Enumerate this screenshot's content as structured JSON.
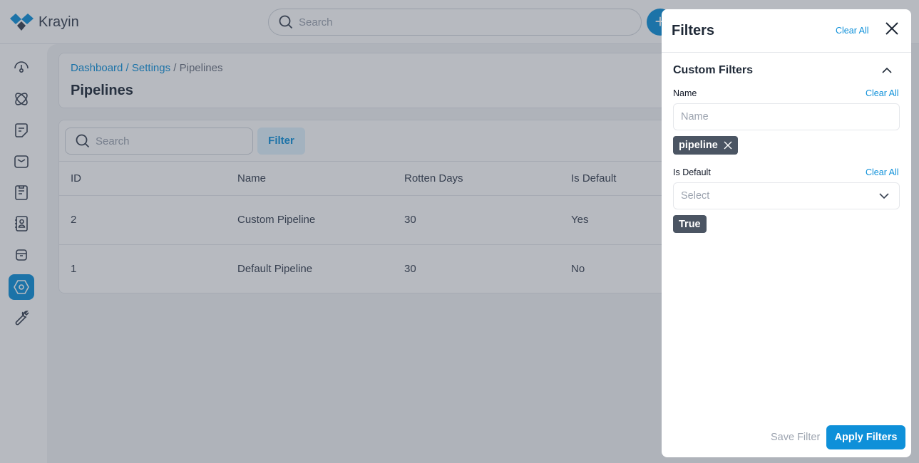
{
  "app": {
    "name": "Krayin",
    "search_placeholder": "Search",
    "brand_color": "#0e90d9"
  },
  "sidebar": {
    "items": [
      {
        "icon": "dashboard-icon"
      },
      {
        "icon": "leads-icon"
      },
      {
        "icon": "quotes-icon"
      },
      {
        "icon": "mail-icon"
      },
      {
        "icon": "activities-icon"
      },
      {
        "icon": "contacts-icon"
      },
      {
        "icon": "products-icon"
      },
      {
        "icon": "settings-icon",
        "active": true
      },
      {
        "icon": "configuration-icon"
      }
    ]
  },
  "page": {
    "breadcrumb": [
      "Dashboard",
      "Settings",
      "Pipelines"
    ],
    "title": "Pipelines"
  },
  "toolbar": {
    "search_placeholder": "Search",
    "filter_label": "Filter"
  },
  "table": {
    "headers": [
      "ID",
      "Name",
      "Rotten Days",
      "Is Default"
    ],
    "rows": [
      [
        "2",
        "Custom Pipeline",
        "30",
        "Yes"
      ],
      [
        "1",
        "Default Pipeline",
        "30",
        "No"
      ]
    ]
  },
  "filters": {
    "title": "Filters",
    "clear_all": "Clear All",
    "section": "Custom Filters",
    "name": {
      "label": "Name",
      "clear": "Clear All",
      "placeholder": "Name",
      "chip": "pipeline"
    },
    "is_default": {
      "label": "Is Default",
      "clear": "Clear All",
      "placeholder": "Select",
      "chip": "True"
    },
    "save_label": "Save Filter",
    "apply_label": "Apply Filters"
  }
}
